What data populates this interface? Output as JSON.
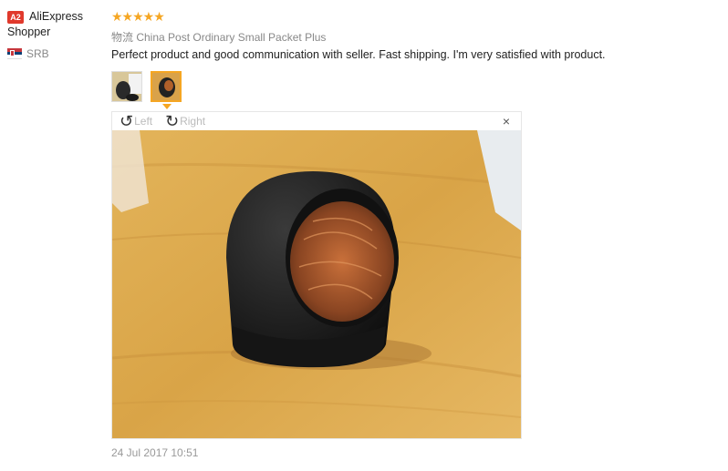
{
  "reviewer": {
    "badge": "A2",
    "name_line1": "AliExpress",
    "name_line2": "Shopper",
    "country": "SRB"
  },
  "review": {
    "stars": "★★★★★",
    "rating": 5,
    "shipping": "物流 China Post Ordinary Small Packet Plus",
    "comment": "Perfect product and good communication with seller. Fast shipping. I'm very satisfied with product.",
    "date": "24 Jul 2017 10:51"
  },
  "viewer": {
    "rotate_left_label": "Left",
    "rotate_right_label": "Right",
    "close_label": "×"
  },
  "icons": {
    "rotate_left": "rotate-left-icon",
    "rotate_right": "rotate-right-icon",
    "close": "close-icon",
    "flag": "serbia-flag-icon"
  },
  "colors": {
    "star": "#f5a623",
    "badge": "#e0392c",
    "active_thumb": "#f5a623"
  }
}
